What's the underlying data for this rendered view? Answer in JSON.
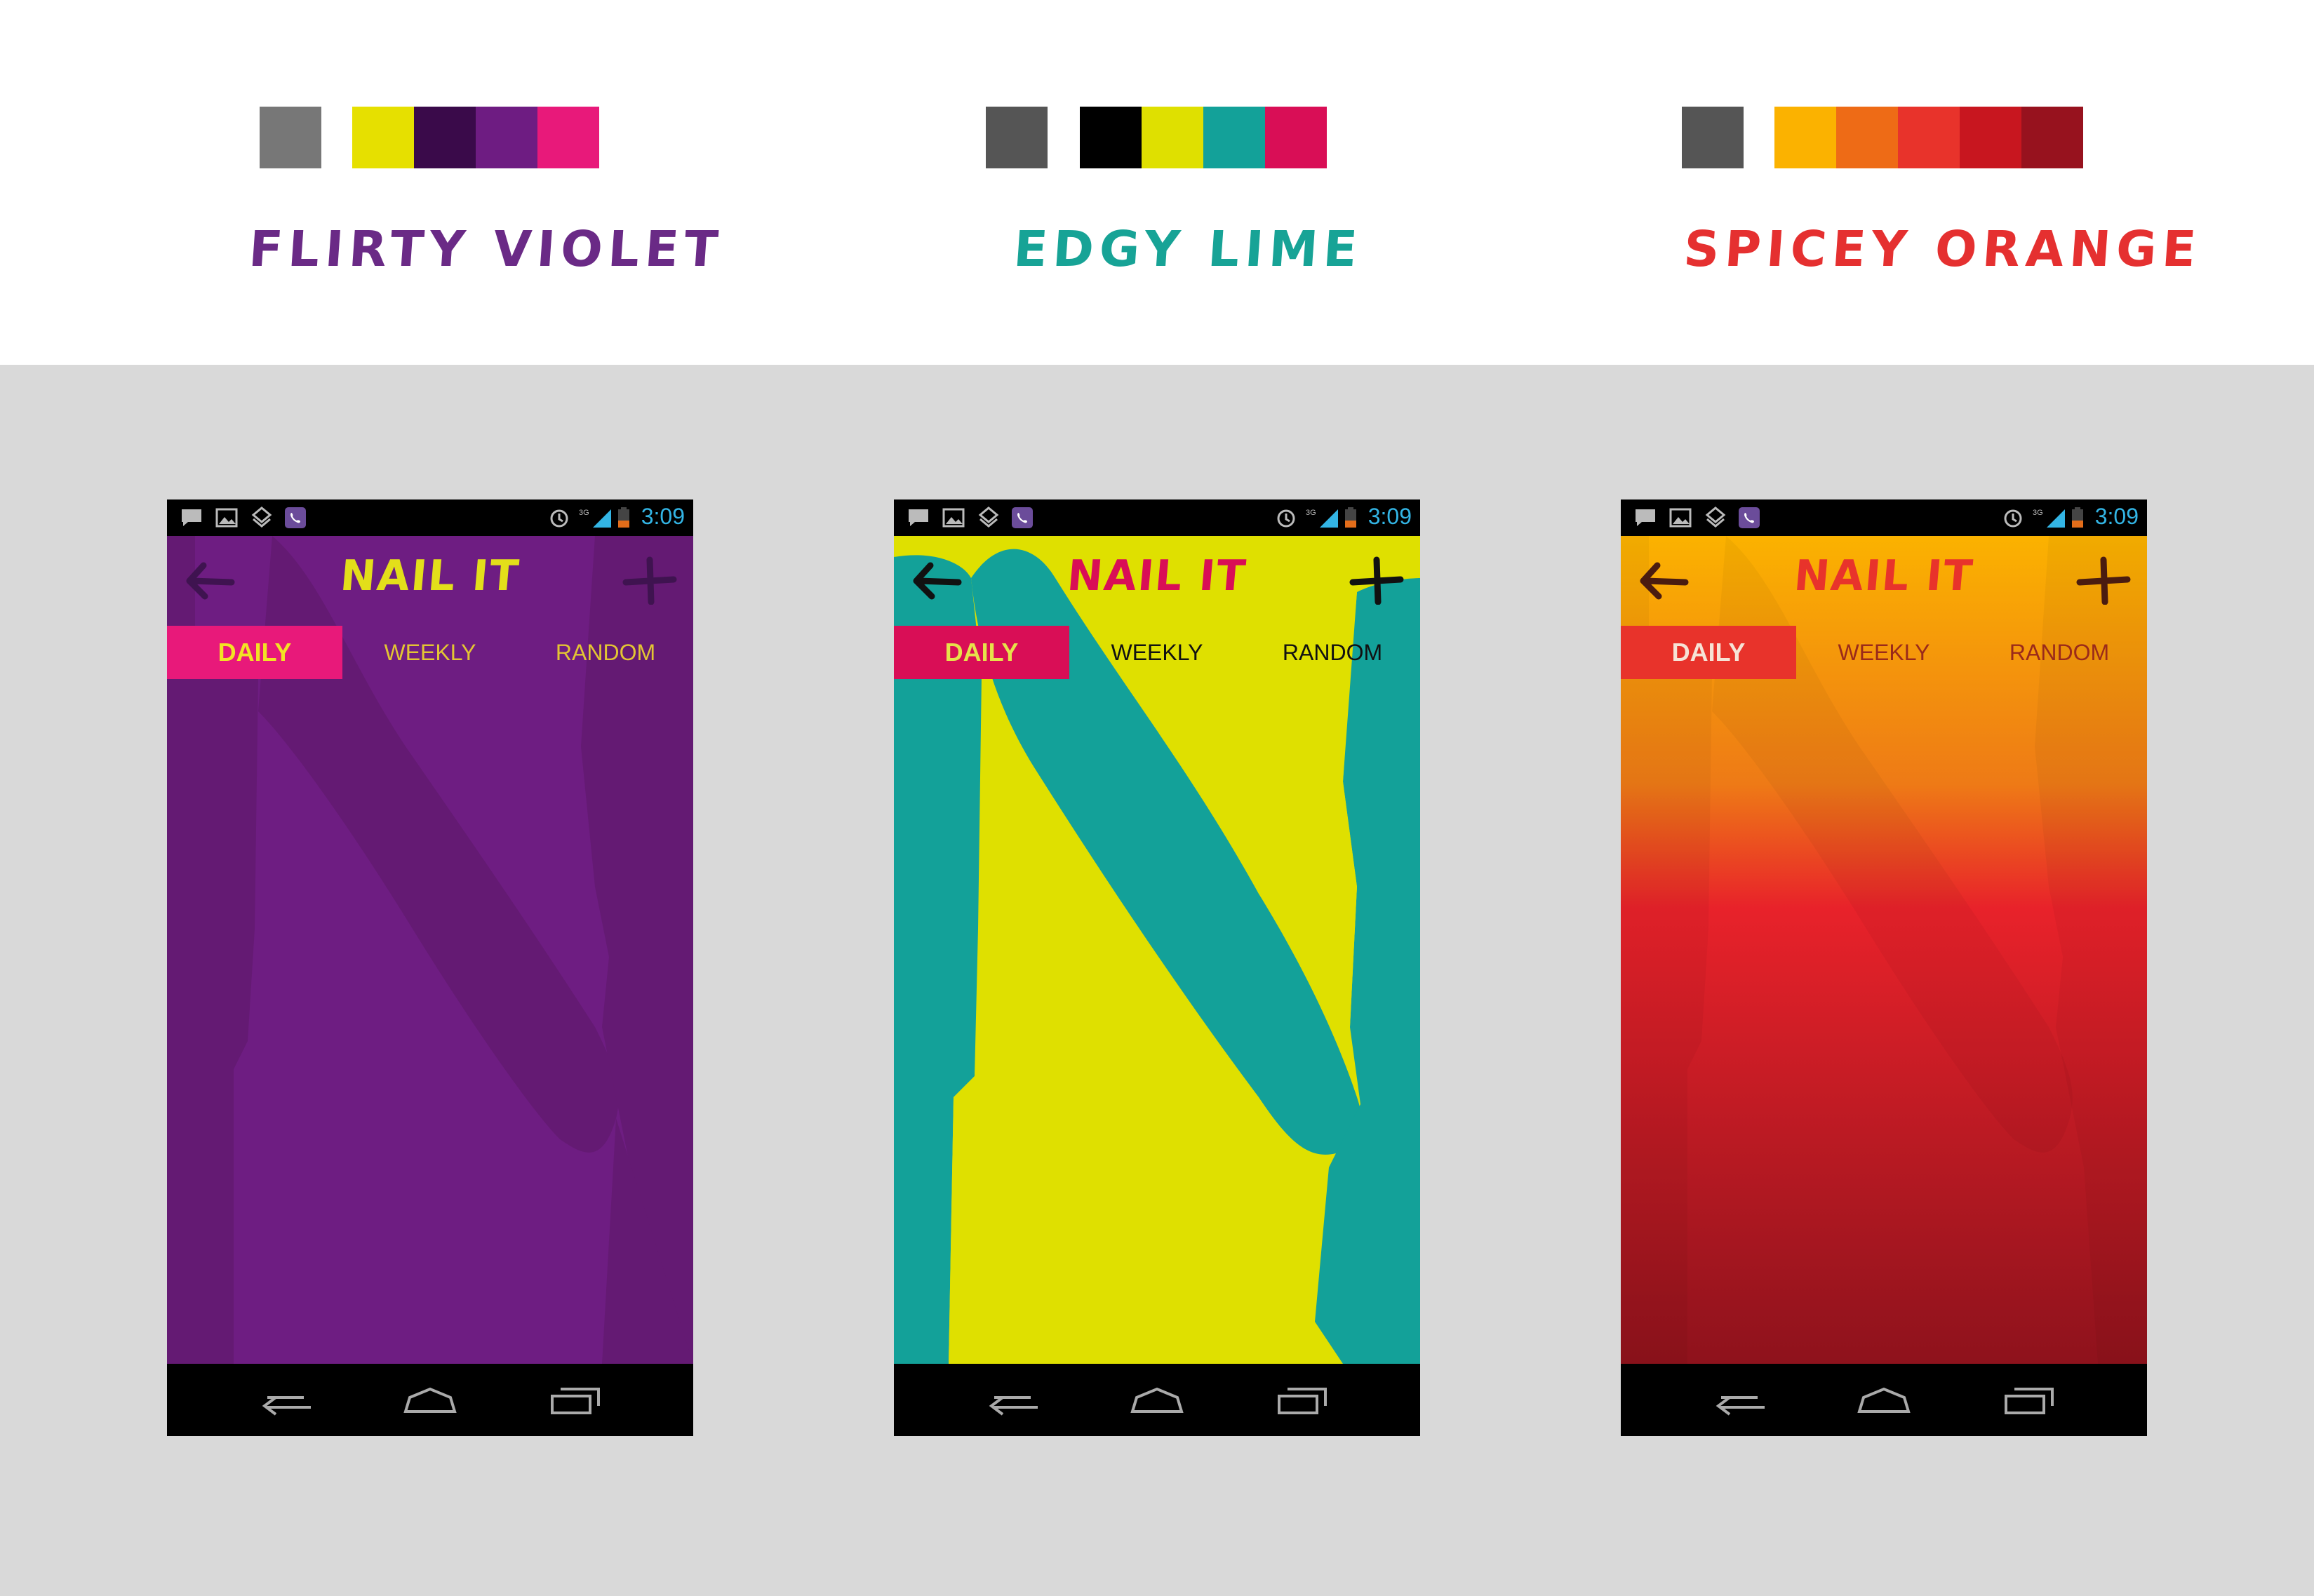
{
  "themes": [
    {
      "name": "Flirty Violet",
      "name_color": "#6a2a86",
      "swatches": [
        "#777777",
        "#e6e000",
        "#3a0a4a",
        "#6e1c82",
        "#e8197a"
      ],
      "phone": {
        "status_time": "3:09",
        "title": "NAIL IT",
        "title_color": "#e3df1a",
        "icon_color": "#3f1350",
        "tabs": [
          "DAILY",
          "WEEKLY",
          "RANDOM"
        ],
        "tab_text_color": "#e3c533",
        "active_tab_bg": "#e8197a",
        "active_tab_text": "#f2e324",
        "bg_main": "#6e1d82",
        "bg_shape": "#641a73"
      }
    },
    {
      "name": "Edgy Lime",
      "name_color": "#17a396",
      "swatches": [
        "#555555",
        "#000000",
        "#dfe000",
        "#13a199",
        "#d90e56"
      ],
      "phone": {
        "status_time": "3:09",
        "title": "NAIL IT",
        "title_color": "#d90e56",
        "icon_color": "#111111",
        "tabs": [
          "DAILY",
          "WEEKLY",
          "RANDOM"
        ],
        "tab_text_color": "#111111",
        "active_tab_bg": "#d90e56",
        "active_tab_text": "#e6e24a",
        "bg_main": "#dfe000",
        "bg_shape": "#13a199"
      }
    },
    {
      "name": "Spicey Orange",
      "name_color": "#e53030",
      "swatches": [
        "#555555",
        "#fbb200",
        "#ee6b16",
        "#e8332b",
        "#c8161f",
        "#97121e"
      ],
      "phone": {
        "status_time": "3:09",
        "title": "NAIL IT",
        "title_color": "#e8332b",
        "icon_color": "#4a1c10",
        "tabs": [
          "DAILY",
          "WEEKLY",
          "RANDOM"
        ],
        "tab_text_color": "#9a2a1a",
        "active_tab_bg": "#e8332b",
        "active_tab_text": "#f6e3d6",
        "bg_top": "#fbb200",
        "bg_mid": "#e8222a",
        "bg_bottom": "#8e121c"
      }
    }
  ]
}
